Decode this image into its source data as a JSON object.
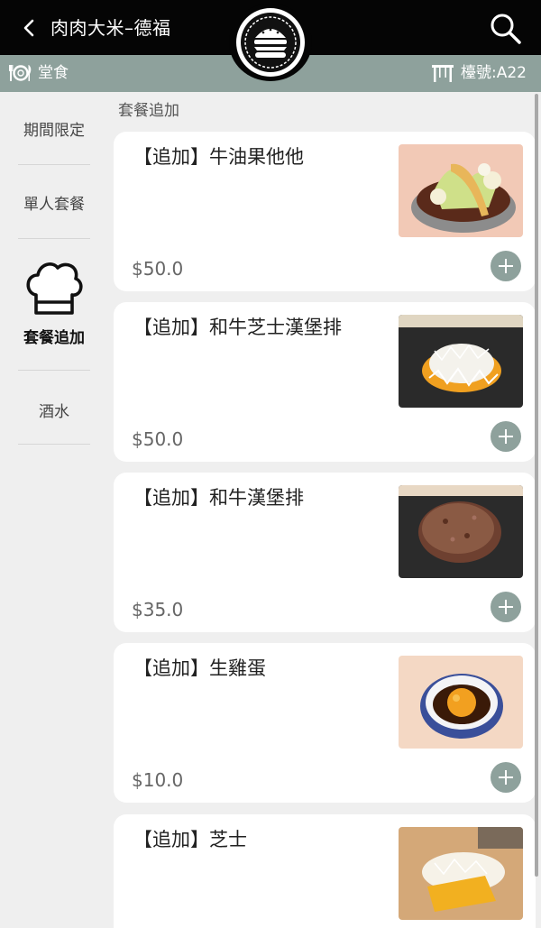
{
  "header": {
    "title": "肉肉大米–德福",
    "back_icon": "chevron-left-icon",
    "search_icon": "search-icon",
    "logo": "restaurant-logo"
  },
  "subbar": {
    "dine_label": "堂食",
    "dine_icon": "plate-cutlery-icon",
    "table_label": "檯號:A22",
    "table_icon": "table-icon"
  },
  "sidebar": {
    "items": [
      {
        "label": "期間限定"
      },
      {
        "label": "單人套餐"
      },
      {
        "label": "套餐追加",
        "active": true,
        "icon": "chef-hat-icon"
      },
      {
        "label": "酒水"
      }
    ]
  },
  "section": {
    "title": "套餐追加"
  },
  "products": [
    {
      "name": "【追加】牛油果他他",
      "price": "$50.0",
      "image": "avocado-tartare-bowl"
    },
    {
      "name": "【追加】和牛芝士漢堡排",
      "price": "$50.0",
      "image": "wagyu-cheese-hamburg-steak"
    },
    {
      "name": "【追加】和牛漢堡排",
      "price": "$35.0",
      "image": "wagyu-hamburg-steak"
    },
    {
      "name": "【追加】生雞蛋",
      "price": "$10.0",
      "image": "raw-egg-bowl"
    },
    {
      "name": "【追加】芝士",
      "price": "",
      "image": "grated-cheese"
    }
  ],
  "colors": {
    "header_bg": "#050505",
    "accent": "#8ea19c",
    "page_bg": "#efefef",
    "card_bg": "#ffffff"
  }
}
